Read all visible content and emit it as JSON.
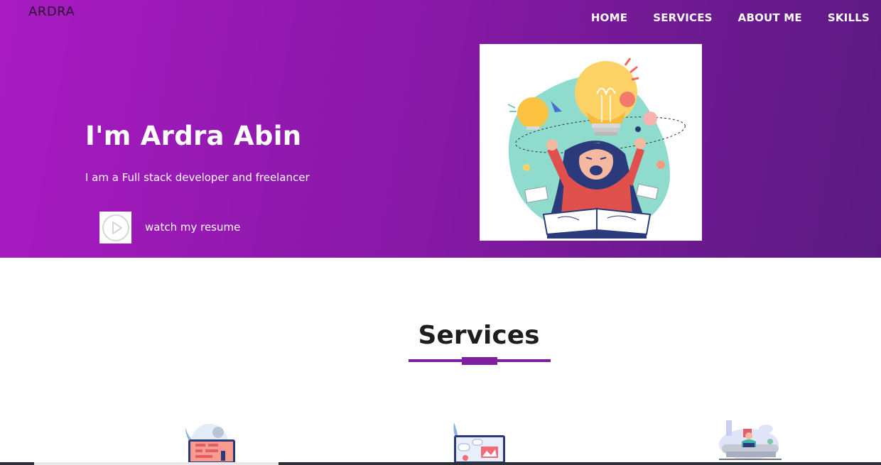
{
  "brand": "ARDRA",
  "nav": {
    "home": "HOME",
    "services": "SERVICES",
    "about": "ABOUT ME",
    "skills": "SKILLS"
  },
  "hero": {
    "title": "I'm Ardra Abin",
    "subtitle": "I am a Full stack developer and freelancer",
    "resume_link": "watch my resume"
  },
  "services": {
    "title": "Services",
    "cards": [
      {
        "icon": "web-design-illustration-icon"
      },
      {
        "icon": "web-development-illustration-icon"
      },
      {
        "icon": "freelance-work-illustration-icon"
      }
    ]
  },
  "colors": {
    "accent": "#7e1fa0",
    "hero_gradient_start": "#a81bc2",
    "hero_gradient_end": "#5b1a82"
  }
}
